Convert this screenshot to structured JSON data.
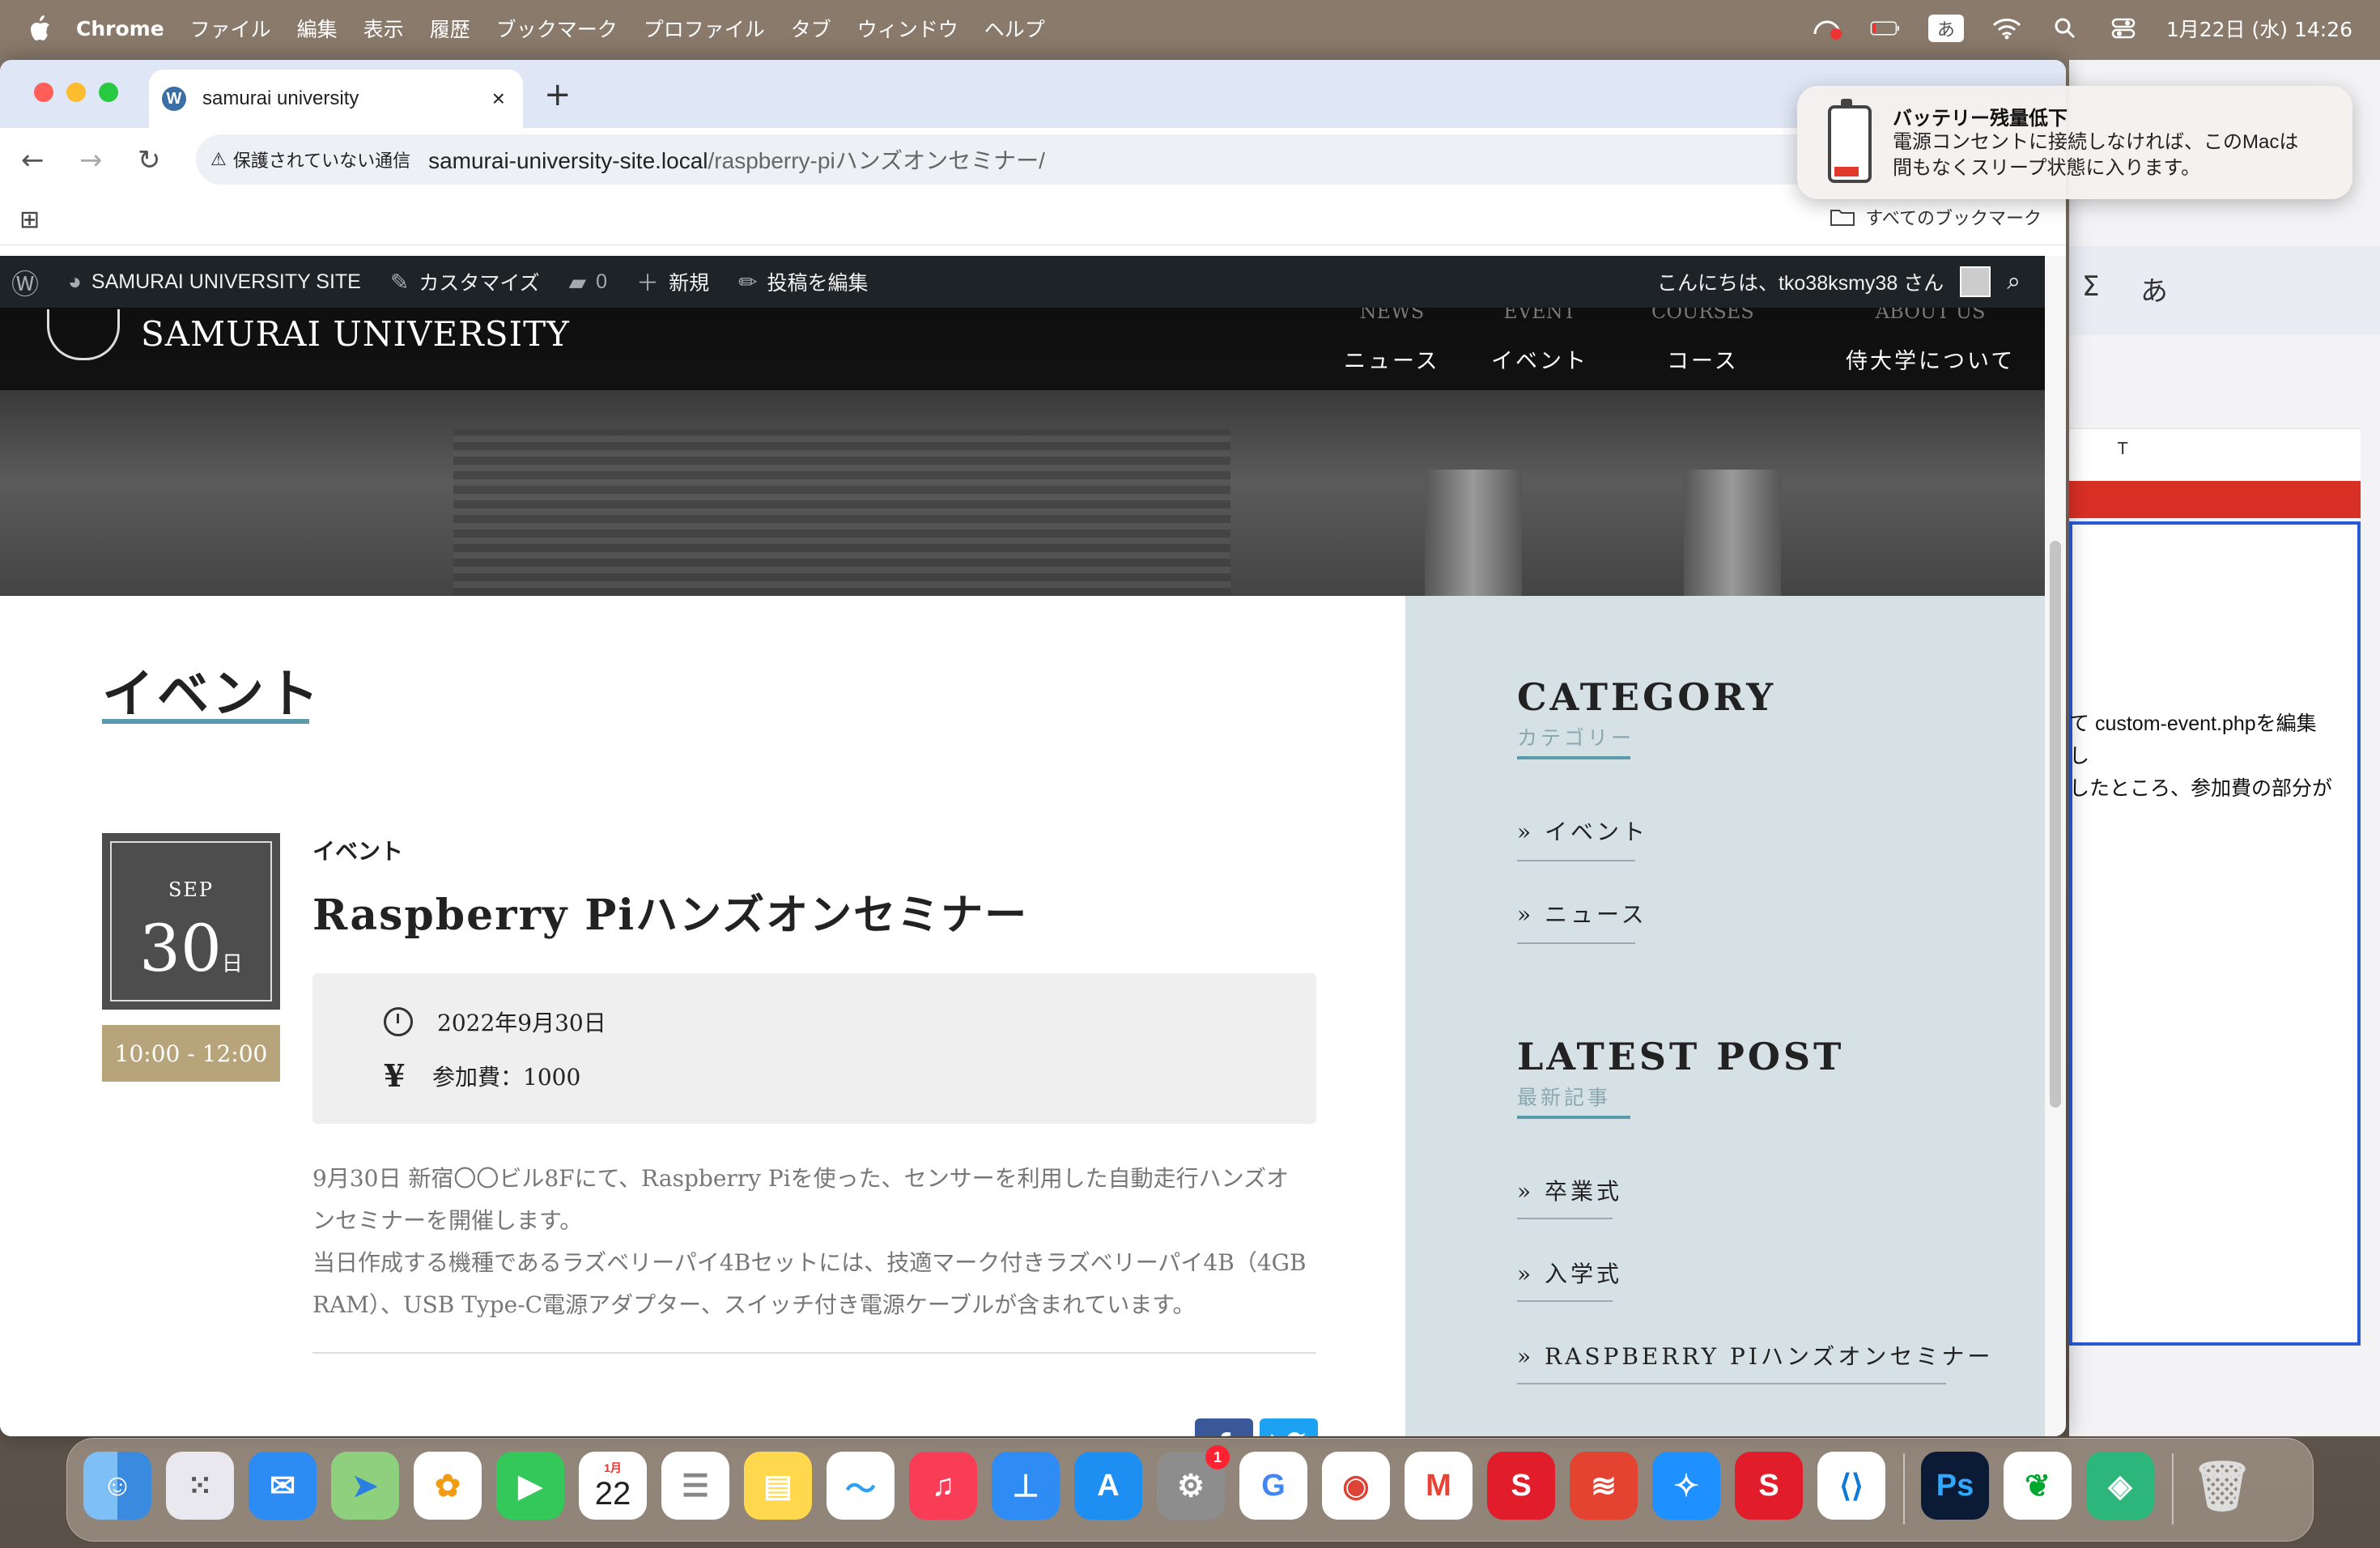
{
  "menubar": {
    "app": "Chrome",
    "menus": [
      "ファイル",
      "編集",
      "表示",
      "履歴",
      "ブックマーク",
      "プロファイル",
      "タブ",
      "ウィンドウ",
      "ヘルプ"
    ],
    "ime": "あ",
    "datetime": "1月22日 (水)  14:26"
  },
  "browser": {
    "tab_title": "samurai university",
    "security": "保護されていない通信",
    "url_domain": "samurai-university-site.local",
    "url_path": "/raspberry-piハンズオンセミナー/",
    "all_bookmarks": "すべてのブックマーク"
  },
  "wp_admin_bar": {
    "site": "SAMURAI UNIVERSITY SITE",
    "customize": "カスタマイズ",
    "comments": "0",
    "new": "新規",
    "edit_post": "投稿を編集",
    "greeting": "こんにちは、tko38ksmy38 さん"
  },
  "site": {
    "name": "SAMURAI UNIVERSITY",
    "nav": [
      {
        "en": "NEWS",
        "ja": "ニュース"
      },
      {
        "en": "EVENT",
        "ja": "イベント"
      },
      {
        "en": "COURSES",
        "ja": "コース"
      },
      {
        "en": "ABOUT US",
        "ja": "侍大学について"
      }
    ]
  },
  "page": {
    "title": "イベント",
    "event": {
      "month": "SEP",
      "day": "30",
      "day_unit": "日",
      "time": "10:00 - 12:00",
      "category": "イベント",
      "title": "Raspberry Piハンズオンセミナー",
      "date": "2022年9月30日",
      "fee_icon": "¥",
      "fee": "参加費：1000",
      "desc1": "9月30日 新宿〇〇ビル8Fにて、Raspberry Piを使った、センサーを利用した自動走行ハンズオ",
      "desc2": "ンセミナーを開催します。",
      "desc3": "当日作成する機種であるラズベリーパイ4Bセットには、技適マーク付きラズベリーパイ4B（4GB",
      "desc4": "RAM）、USB Type-C電源アダプター、スイッチ付き電源ケーブルが含まれています。"
    }
  },
  "sidebar": {
    "category_heading": "CATEGORY",
    "category_sub": "カテゴリー",
    "categories": [
      "» イベント",
      "» ニュース"
    ],
    "latest_heading": "LATEST POST",
    "latest_sub": "最新記事",
    "latest": [
      "» 卒業式",
      "» 入学式",
      "» RASPBERRY PIハンズオンセミナー"
    ]
  },
  "notification": {
    "title": "バッテリー残量低下",
    "line1": "電源コンセントに接続しなければ、このMacは",
    "line2": "間もなくスリープ状態に入ります。"
  },
  "background_window": {
    "col": "T",
    "text1": "て custom-event.phpを編集し",
    "text2": "したところ、参加費の部分が",
    "sigma": "Σ",
    "ime": "あ"
  },
  "dock": {
    "calendar_month": "1月",
    "calendar_day": "22",
    "settings_badge": "1",
    "ps_label": "Ps"
  },
  "colors": {
    "accent": "#5b9aaa",
    "time_gold": "#b7a47a",
    "sidebar_bg": "#d6e1e6",
    "wp_bar": "#1d2327"
  }
}
